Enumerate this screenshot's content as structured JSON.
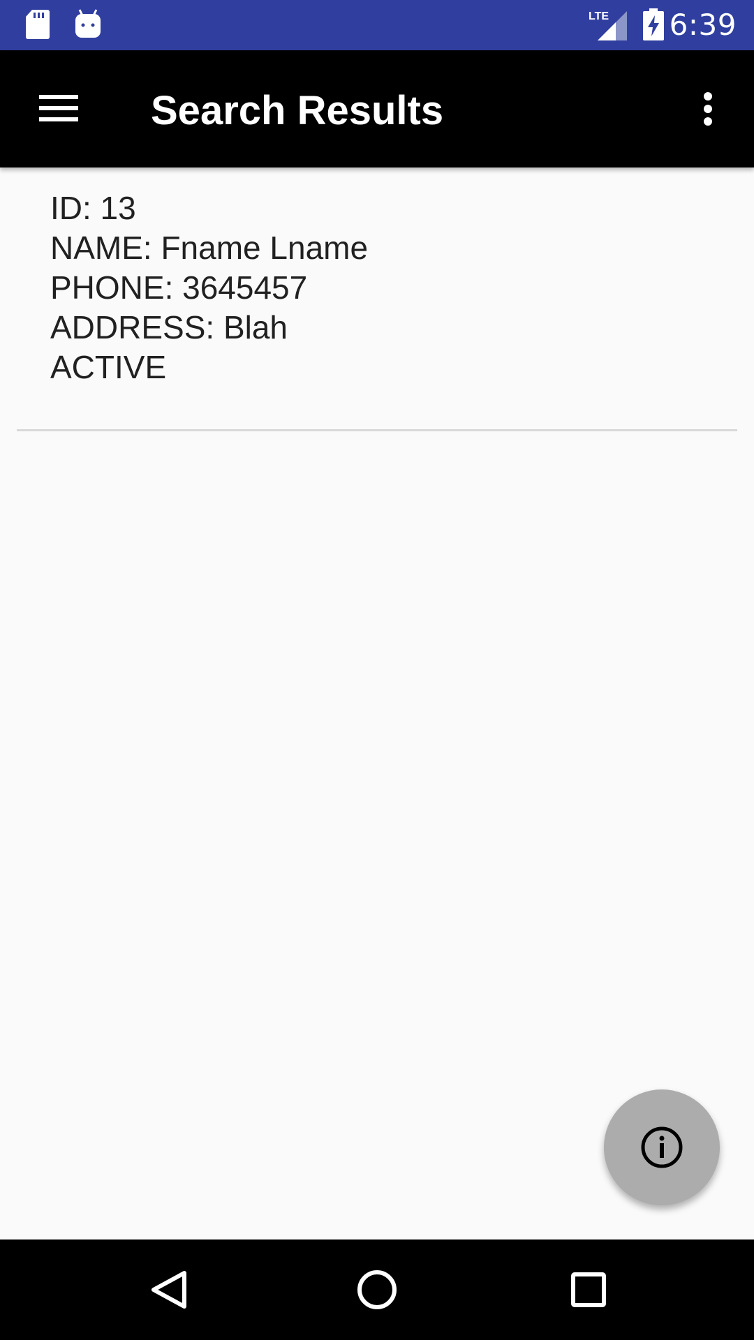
{
  "status_bar": {
    "time": "6:39",
    "icons": [
      "sd-card-icon",
      "android-debug-icon",
      "lte-signal-icon",
      "battery-charging-icon"
    ],
    "background_color": "#303f9f"
  },
  "app_bar": {
    "title": "Search Results",
    "menu_icon": "hamburger-menu-icon",
    "overflow_icon": "more-vert-icon",
    "background_color": "#000000"
  },
  "results": [
    {
      "id_line": "ID: 13",
      "name_line": "NAME: Fname Lname",
      "phone_line": "PHONE: 3645457",
      "address_line": "ADDRESS: Blah",
      "status_line": "ACTIVE"
    }
  ],
  "fab": {
    "icon": "info-icon",
    "color": "#acacac"
  },
  "nav_bar": {
    "icons": [
      "back-icon",
      "home-icon",
      "recents-icon"
    ]
  }
}
